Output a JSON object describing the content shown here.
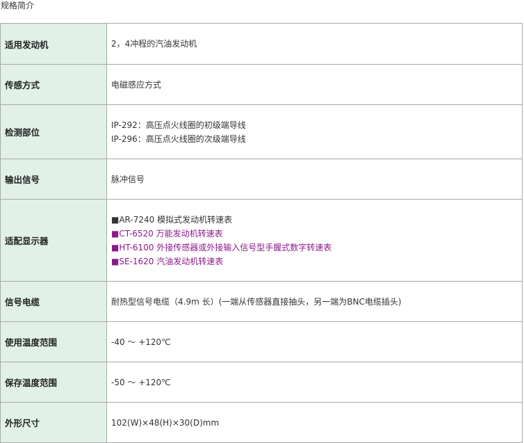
{
  "page_title": "规格简介",
  "colors": {
    "label_bg": "#e1f1e8",
    "border": "#a8a8a8",
    "highlight": "#8b1a8b"
  },
  "rows": [
    {
      "label": "适用发动机",
      "lines": [
        "2，4冲程的汽油发动机"
      ]
    },
    {
      "label": "传感方式",
      "lines": [
        "电磁感应方式"
      ]
    },
    {
      "label": "检测部位",
      "lines": [
        "IP-292：高压点火线圈的初级端导线",
        "IP-296：高压点火线圈的次级端导线"
      ]
    },
    {
      "label": "输出信号",
      "lines": [
        "脉冲信号"
      ]
    },
    {
      "label": "适配显示器",
      "lines": [
        "■AR-7240 模拟式发动机转速表",
        "■CT-6520 万能发动机转速表",
        "■HT-6100 外接传感器或外接输入信号型手握式数字转速表",
        "■SE-1620 汽油发动机转速表"
      ]
    },
    {
      "label": "信号电缆",
      "lines": [
        "耐热型信号电缆（4.9m 长）(一端从传感器直接抽头，另一端为BNC电缆插头)"
      ]
    },
    {
      "label": "使用温度范围",
      "lines": [
        "-40 ～ +120℃"
      ]
    },
    {
      "label": "保存温度范围",
      "lines": [
        "-50 ～ +120℃"
      ]
    },
    {
      "label": "外形尺寸",
      "lines": [
        "102(W)×48(H)×30(D)mm"
      ]
    }
  ]
}
